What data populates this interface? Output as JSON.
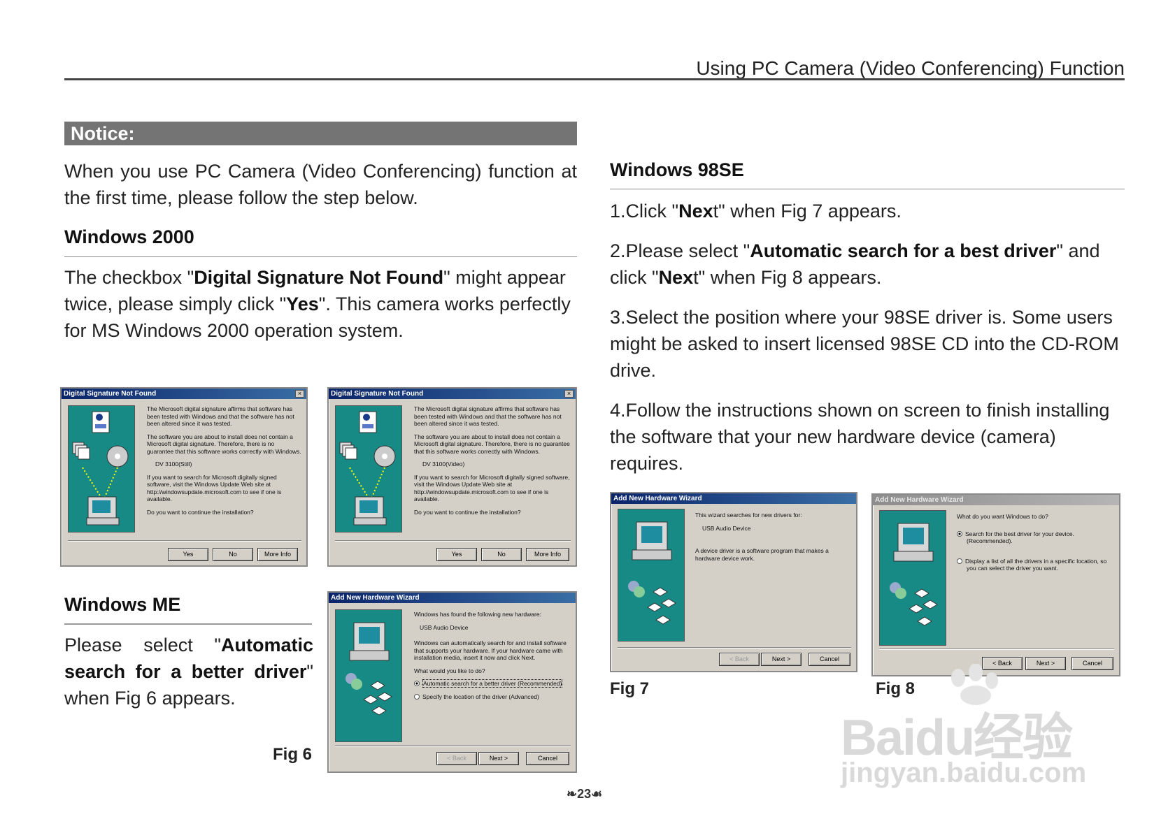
{
  "header": {
    "title": "Using PC Camera (Video Conferencing) Function"
  },
  "notice": {
    "title": "Notice:",
    "intro": "When you use PC Camera (Video Conferencing) function at the first time, please follow the step below."
  },
  "win2000": {
    "heading": "Windows 2000",
    "p1": "The checkbox \"",
    "b1": "Digital Signature Not Found",
    "p2": "\" might appear twice, please simply click \"",
    "b2": "Yes",
    "p3": "\". This camera works perfectly for MS Windows 2000 operation system."
  },
  "winme": {
    "heading": "Windows ME",
    "p1": "Please select \"",
    "b1": "Automatic search for a better driver",
    "p2": "\" when Fig 6 appears."
  },
  "win98": {
    "heading": "Windows 98SE",
    "s1_a": "1.Click \"",
    "s1_b": "Nex",
    "s1_c": "t\" when Fig 7 appears.",
    "s2_a": "2.Please select \"",
    "s2_b": "Automatic search for a best driver",
    "s2_c": "\" and click \"",
    "s2_d": "Nex",
    "s2_e": "t\" when Fig 8 appears.",
    "s3": "3.Select the position where your 98SE driver is. Some users might be asked to insert licensed 98SE CD into the CD-ROM drive.",
    "s4": "4.Follow the instructions shown on screen to finish installing the software that your new hardware device (camera) requires."
  },
  "figs": {
    "fig6": "Fig 6",
    "fig7": "Fig 7",
    "fig8": "Fig 8"
  },
  "dlg_sig1": {
    "title": "Digital Signature Not Found",
    "t1": "The Microsoft digital signature affirms that software has been tested with Windows and that the software has not been altered since it was tested.",
    "t2": "The software you are about to install does not contain a Microsoft digital signature. Therefore, there is no guarantee that this software works correctly with Windows.",
    "device": "DV 3100(Still)",
    "t3": "If you want to search for Microsoft digitally signed software, visit the Windows Update Web site at http://windowsupdate.microsoft.com to see if one is available.",
    "t4": "Do you want to continue the installation?",
    "yes": "Yes",
    "no": "No",
    "more": "More Info"
  },
  "dlg_sig2": {
    "title": "Digital Signature Not Found",
    "t1": "The Microsoft digital signature affirms that software has been tested with Windows and that the software has not been altered since it was tested.",
    "t2": "The software you are about to install does not contain a Microsoft digital signature. Therefore, there is no guarantee that this software works correctly with Windows.",
    "device": "DV 3100(Video)",
    "t3": "If you want to search for Microsoft digitally signed software, visit the Windows Update Web site at http://windowsupdate.microsoft.com to see if one is available.",
    "t4": "Do you want to continue the installation?",
    "yes": "Yes",
    "no": "No",
    "more": "More Info"
  },
  "dlg_me": {
    "title": "Add New Hardware Wizard",
    "t1": "Windows has found the following new hardware:",
    "device": "USB Audio Device",
    "t2": "Windows can automatically search for and install software that supports your hardware. If your hardware came with installation media, insert it now and click Next.",
    "t3": "What would you like to do?",
    "opt1": "Automatic search for a better driver (Recommended)",
    "opt2": "Specify the location of the driver (Advanced)",
    "back": "< Back",
    "next": "Next >",
    "cancel": "Cancel"
  },
  "dlg_fig7": {
    "title": "Add New Hardware Wizard",
    "t1": "This wizard searches for new drivers for:",
    "device": "USB Audio Device",
    "t2": "A device driver is a software program that makes a hardware device work.",
    "back": "< Back",
    "next": "Next >",
    "cancel": "Cancel"
  },
  "dlg_fig8": {
    "title": "Add New Hardware Wizard",
    "t1": "What do you want Windows to do?",
    "opt1": "Search for the best driver for your device. (Recommended).",
    "opt2": "Display a list of all the drivers in a specific location, so you can select the driver you want.",
    "back": "< Back",
    "next": "Next >",
    "cancel": "Cancel"
  },
  "footer": {
    "page": "23"
  },
  "watermark": {
    "brand": "Baidu经验",
    "url": "jingyan.baidu.com"
  }
}
